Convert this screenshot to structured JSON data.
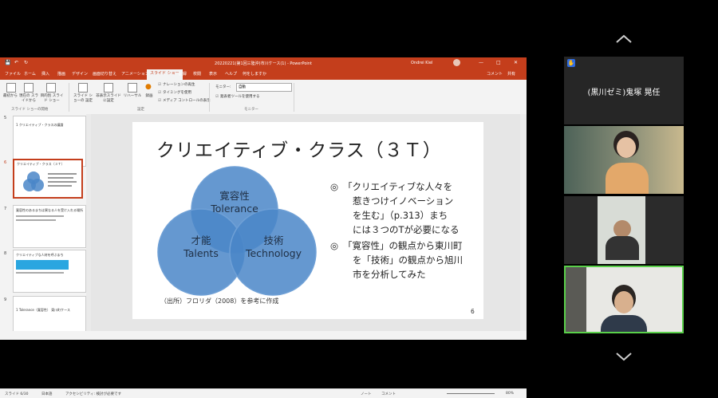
{
  "ppt": {
    "window_title": "20220221(第1回三陸沖)市川ケース(1)  -  PowerPoint",
    "user_name": "Ondrei Kiel",
    "window_controls": [
      "—",
      "□",
      "✕"
    ],
    "tabs": [
      "ファイル",
      "ホーム",
      "挿入",
      "描画",
      "デザイン",
      "画面切り替え",
      "アニメーション",
      "スライド ショー",
      "記録",
      "校閲",
      "表示",
      "ヘルプ",
      "何をしますか"
    ],
    "active_tab": "スライド ショー",
    "share_label": "共有",
    "comment_label": "コメント",
    "ribbon": {
      "start_buttons": [
        "最初から",
        "現在の スライドから",
        "目的別 スライド ショー"
      ],
      "start_group": "スライド ショーの開始",
      "setup_buttons": [
        "スライド ショーの 設定",
        "非表示スライド に設定",
        "リハーサル",
        "録画"
      ],
      "checks": [
        "ナレーションの再生",
        "タイミングを使用",
        "メディア コントロールの表示"
      ],
      "setup_group": "設定",
      "monitor_label": "モニター:",
      "monitor_value": "自動",
      "presenter_label": "発表者ツールを使用する",
      "monitor_group": "モニター"
    },
    "thumbs": [
      {
        "num": "5",
        "text": "1  クリエイティブ・クラスの議論"
      },
      {
        "num": "6",
        "text": "クリエイティブ・クラス（３Ｔ）"
      },
      {
        "num": "7",
        "text": "寛容性のあるまちは異なる人を受け入れる場所"
      },
      {
        "num": "8",
        "text": "クリエイティブな人材を呼ぶまち"
      },
      {
        "num": "9",
        "text": "1  Tolerance（寛容性）  東川町ケース"
      }
    ],
    "status": {
      "slide_count": "スライド 6/30",
      "language": "日本語",
      "accessibility": "アクセシビリティ: 検討が必要です",
      "notes": "ノート",
      "comments": "コメント",
      "zoom": "80%"
    }
  },
  "slide": {
    "title": "クリエイティブ・クラス（３Ｔ）",
    "circles": [
      {
        "line1": "寛容性",
        "line2": "Tolerance"
      },
      {
        "line1": "才能",
        "line2": "Talents"
      },
      {
        "line1": "技術",
        "line2": "Technology"
      }
    ],
    "bullet_marker": "◎",
    "bullet1": [
      "「クリエイティブな人々を",
      "惹きつけイノベーション",
      "を生む」（p.313）まち",
      "には３つのTが必要になる"
    ],
    "bullet2": [
      "「寛容性」の観点から東川町",
      "を「技術」の観点から旭川",
      "市を分析してみた"
    ],
    "source": "（出所）フロリダ（2008）を参考に作成",
    "page_number": "6"
  },
  "zoom": {
    "participant_name": "(黒川ゼミ)鬼塚 晃任",
    "up_arrow": "chevron-up",
    "down_arrow": "chevron-down"
  },
  "colors": {
    "ppt_accent": "#c43e1c",
    "venn_fill": "#4a86c8",
    "zoom_active_border": "#5ad04a"
  }
}
